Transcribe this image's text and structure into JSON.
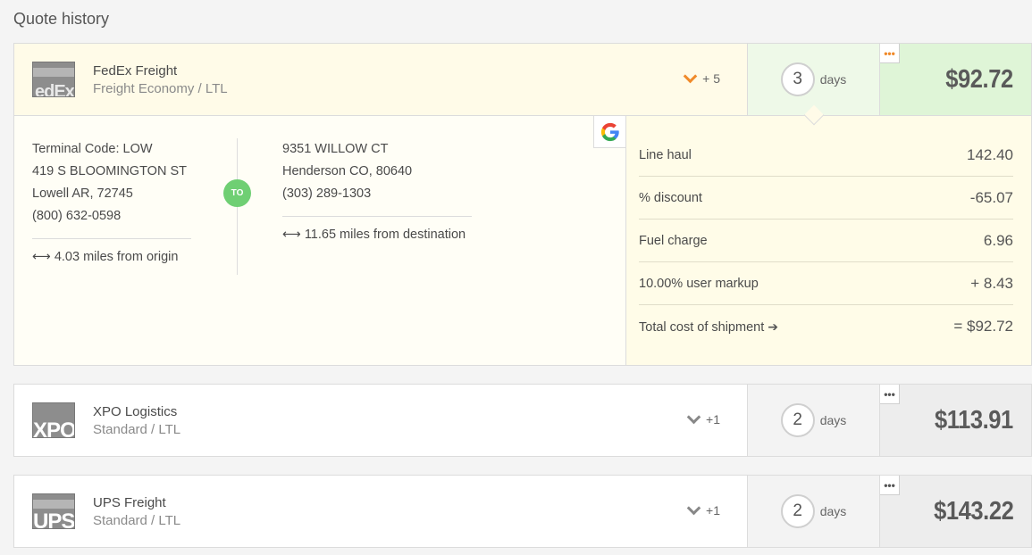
{
  "page": {
    "title": "Quote history"
  },
  "quotes": [
    {
      "carrier": "FedEx Freight",
      "service": "Freight Economy / LTL",
      "logo_text": "edEx",
      "more_count": "+ 5",
      "days": "3",
      "days_label": "days",
      "price": "$92.72",
      "dots": "•••",
      "selected": true,
      "origin": {
        "lines": [
          "Terminal Code: LOW",
          "419 S BLOOMINGTON ST",
          "Lowell AR, 72745",
          "(800) 632-0598"
        ],
        "distance": "⟷ 4.03 miles from origin"
      },
      "to_label": "TO",
      "destination": {
        "lines": [
          "9351 WILLOW CT",
          "Henderson CO, 80640",
          "(303) 289-1303"
        ],
        "distance": "⟷ 11.65 miles from destination"
      },
      "breakdown": [
        {
          "label": "Line haul",
          "value": "142.40"
        },
        {
          "label": "% discount",
          "value": "-65.07"
        },
        {
          "label": "Fuel charge",
          "value": "6.96"
        },
        {
          "label": "10.00% user markup",
          "value": "+ 8.43"
        },
        {
          "label": "Total cost of shipment",
          "value": "= $92.72"
        }
      ]
    },
    {
      "carrier": "XPO Logistics",
      "service": "Standard / LTL",
      "logo_text": "XPO",
      "more_count": "+1",
      "days": "2",
      "days_label": "days",
      "price": "$113.91",
      "dots": "•••",
      "selected": false
    },
    {
      "carrier": "UPS Freight",
      "service": "Standard / LTL",
      "logo_text": "UPS",
      "more_count": "+1",
      "days": "2",
      "days_label": "days",
      "price": "$143.22",
      "dots": "•••",
      "selected": false
    }
  ],
  "icons": {
    "chevron": "chevron-down-icon",
    "distance": "double-arrow-icon",
    "google": "google-icon",
    "arrow": "arrow-right-icon"
  },
  "colors": {
    "accent_orange": "#f08a2a",
    "to_green": "#6fcf73",
    "selected_price_bg": "#dff5d7",
    "selected_bg": "#fffbe8"
  }
}
